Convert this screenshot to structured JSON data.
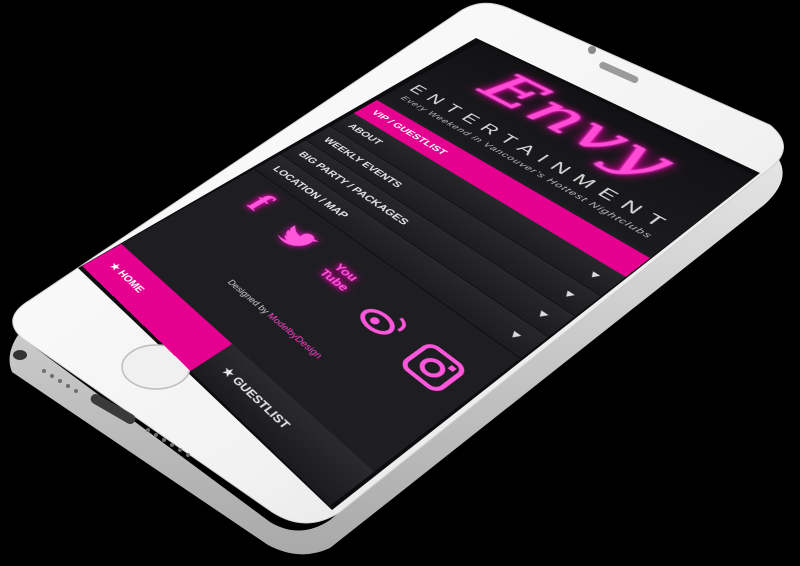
{
  "app": {
    "logo_script": "Envy",
    "logo_word": "ENTERTAINMENT",
    "tagline": "Every Weekend in Vancouver's Hottest Nightclubs"
  },
  "menu": {
    "items": [
      {
        "label": "VIP / GUESTLIST",
        "active": true
      },
      {
        "label": "ABOUT",
        "active": false
      },
      {
        "label": "WEEKLY EVENTS",
        "active": false
      },
      {
        "label": "BIG PARTY / PACKAGES",
        "active": false
      },
      {
        "label": "LOCATION / MAP",
        "active": false
      }
    ],
    "chevron_icon": "chevron-down-icon"
  },
  "social": {
    "icons": [
      "facebook-icon",
      "twitter-icon",
      "youtube-icon",
      "weibo-icon",
      "instagram-icon"
    ],
    "facebook_glyph": "f",
    "youtube_glyph": "You Tube"
  },
  "credit": {
    "prefix": "Designed by",
    "brand": "ModelbyDesign"
  },
  "tabbar": {
    "home": "HOME",
    "guestlist": "GUESTLIST"
  },
  "colors": {
    "accent": "#e5008f",
    "neon": "#ff56dc",
    "screen_bg": "#1e1e22",
    "phone_body": "#f4f4f4"
  }
}
